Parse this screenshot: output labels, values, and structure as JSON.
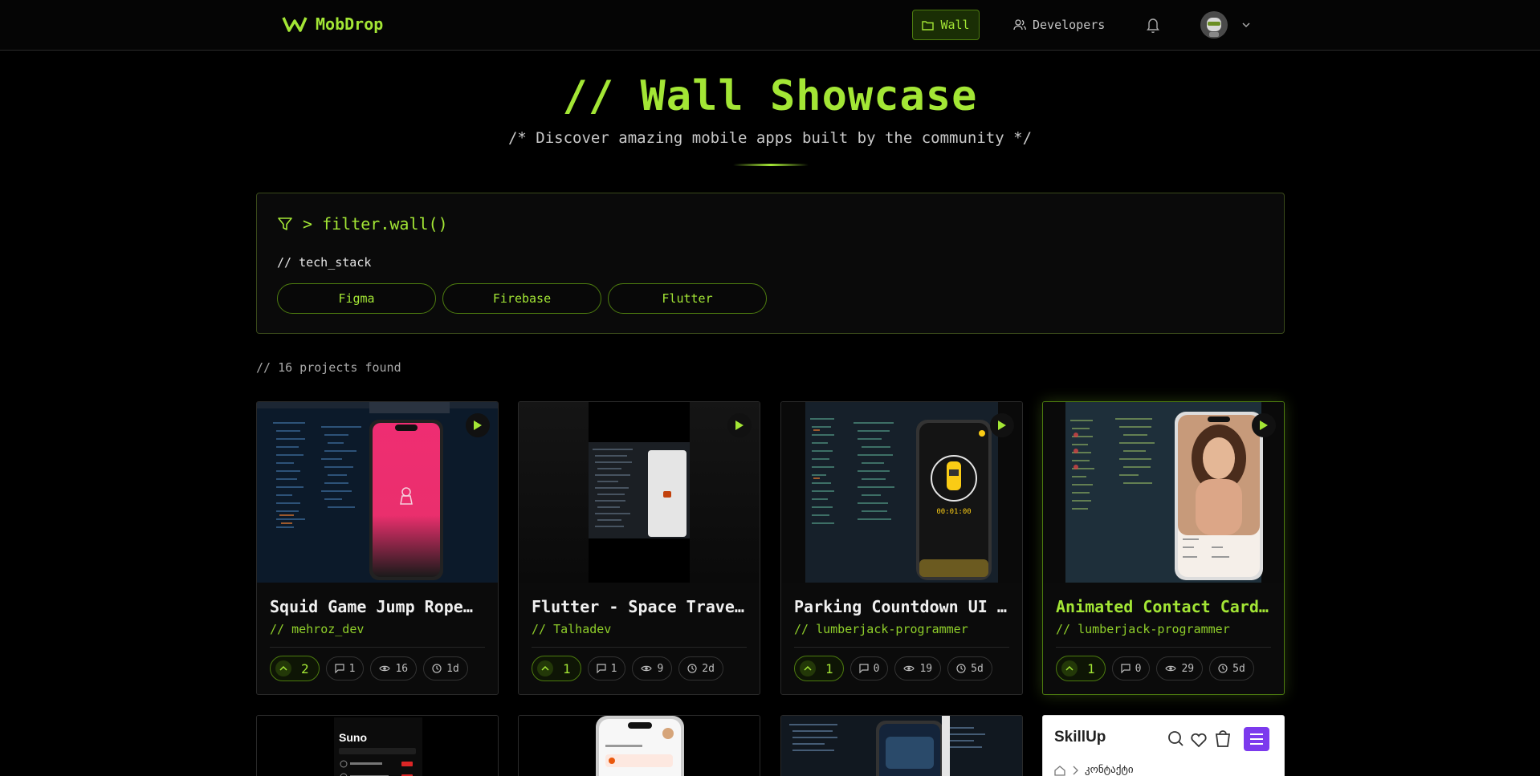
{
  "nav": {
    "brand": "MobDrop",
    "wall": "Wall",
    "developers": "Developers"
  },
  "hero": {
    "title": "// Wall Showcase",
    "subtitle": "/* Discover amazing mobile apps built by the community */"
  },
  "filter": {
    "heading": "> filter.wall()",
    "label": "// tech_stack",
    "chips": [
      "Figma",
      "Firebase",
      "Flutter"
    ]
  },
  "count": "// 16 projects found",
  "cards": [
    {
      "title": "Squid Game Jump Rope…",
      "author": "// mehroz_dev",
      "votes": "2",
      "comments": "1",
      "views": "16",
      "age": "1d"
    },
    {
      "title": "Flutter - Space Travel…",
      "author": "// Talhadev",
      "votes": "1",
      "comments": "1",
      "views": "9",
      "age": "2d"
    },
    {
      "title": "Parking Countdown UI -…",
      "author": "// lumberjack-programmer",
      "votes": "1",
      "comments": "0",
      "views": "19",
      "age": "5d"
    },
    {
      "title": "Animated Contact Card U…",
      "author": "// lumberjack-programmer",
      "votes": "1",
      "comments": "0",
      "views": "29",
      "age": "5d"
    }
  ],
  "thumbs": {
    "parking_timer": "00:01:00",
    "row2_suno": "Suno",
    "row2_skillup": "SkillUp",
    "row2_breadcrumb": "კონტაქტი"
  },
  "colors": {
    "accent": "#a3e635",
    "background": "#000000",
    "border": "#2a2a2a"
  }
}
